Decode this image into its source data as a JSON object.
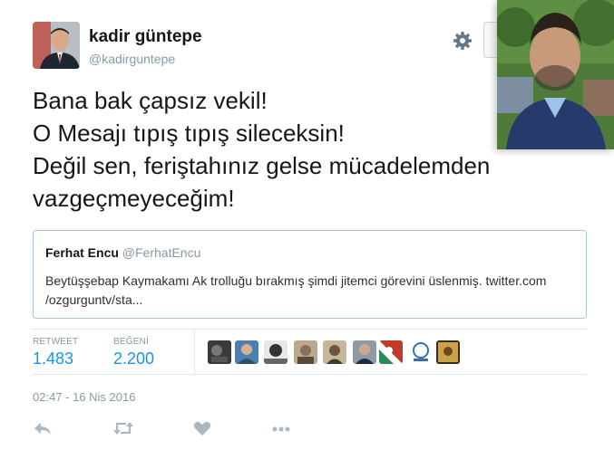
{
  "tweet": {
    "author": {
      "name": "kadir güntepe",
      "handle": "@kadirguntepe"
    },
    "text_lines": [
      "Bana bak çapsız vekil!",
      "O Mesajı tıpış tıpış sileceksin!",
      "Değil sen, feriştahınız gelse mücadelemden",
      "vazgeçmeyeceğim!"
    ],
    "quoted": {
      "name": "Ferhat Encu",
      "handle": "@FerhatEncu",
      "text_line1": "Beytüşşebap Kaymakamı Ak trolluğu bırakmış şimdi jitemci görevini üslenmiş.  twitter.com",
      "text_line2": "/ozgurguntv/sta..."
    },
    "stats": {
      "retweets_label": "RETWEET",
      "retweets": "1.483",
      "likes_label": "BEĞENİ",
      "likes": "2.200"
    },
    "liker_avatar_count": 10,
    "timestamp": "02:47 - 16 Nis 2016"
  },
  "icons": {
    "settings": "gear-icon",
    "reply": "reply-icon",
    "retweet": "retweet-icon",
    "like": "heart-icon",
    "more": "more-dots-icon"
  },
  "colors": {
    "link_blue": "#1b95e0",
    "muted_gray": "#8899a6",
    "icon_gray": "#aab8c2",
    "quote_border": "#a8c4db"
  }
}
